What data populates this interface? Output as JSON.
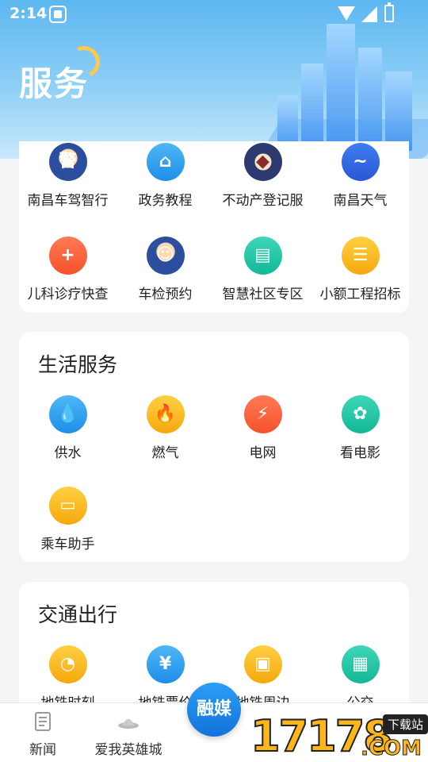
{
  "status_bar": {
    "time": "2:14"
  },
  "header": {
    "title": "服务"
  },
  "top_services": [
    {
      "label": "南昌车驾智行",
      "icon": "police-avatar-icon",
      "glyph": "警"
    },
    {
      "label": "政务教程",
      "icon": "building-icon",
      "glyph": "⌂"
    },
    {
      "label": "不动产登记服",
      "icon": "property-seal-icon",
      "glyph": "◆"
    },
    {
      "label": "南昌天气",
      "icon": "bird-icon",
      "glyph": "~"
    },
    {
      "label": "儿科诊疗快查",
      "icon": "clinic-icon",
      "glyph": "+"
    },
    {
      "label": "车检预约",
      "icon": "inspector-avatar-icon",
      "glyph": "☺"
    },
    {
      "label": "智慧社区专区",
      "icon": "community-icon",
      "glyph": "▤"
    },
    {
      "label": "小额工程招标",
      "icon": "tender-document-icon",
      "glyph": "☰"
    }
  ],
  "life_section": {
    "title": "生活服务",
    "items": [
      {
        "label": "供水",
        "icon": "water-drop-icon",
        "glyph": "💧"
      },
      {
        "label": "燃气",
        "icon": "flame-icon",
        "glyph": "🔥"
      },
      {
        "label": "电网",
        "icon": "lightning-icon",
        "glyph": "⚡"
      },
      {
        "label": "看电影",
        "icon": "film-reel-icon",
        "glyph": "✿"
      },
      {
        "label": "乘车助手",
        "icon": "bus-card-icon",
        "glyph": "▭"
      }
    ]
  },
  "traffic_section": {
    "title": "交通出行",
    "items": [
      {
        "label": "地铁时刻",
        "icon": "clock-icon",
        "glyph": "◔"
      },
      {
        "label": "地铁票价",
        "icon": "ticket-icon",
        "glyph": "¥"
      },
      {
        "label": "地铁周边",
        "icon": "metro-train-icon",
        "glyph": "▣"
      },
      {
        "label": "公交",
        "icon": "bus-icon",
        "glyph": "▦"
      }
    ]
  },
  "bottom_nav": {
    "items": [
      {
        "label": "新闻",
        "icon": "news-icon"
      },
      {
        "label": "爱我英雄城",
        "icon": "city-hat-icon"
      }
    ],
    "center_label": "融媒"
  },
  "watermark": {
    "number": "17178",
    "badge": "下载站",
    "suffix": ".COM"
  },
  "colors": {
    "primary_blue": "#1d8ee8",
    "header_gradient_top": "#5db7f0"
  }
}
